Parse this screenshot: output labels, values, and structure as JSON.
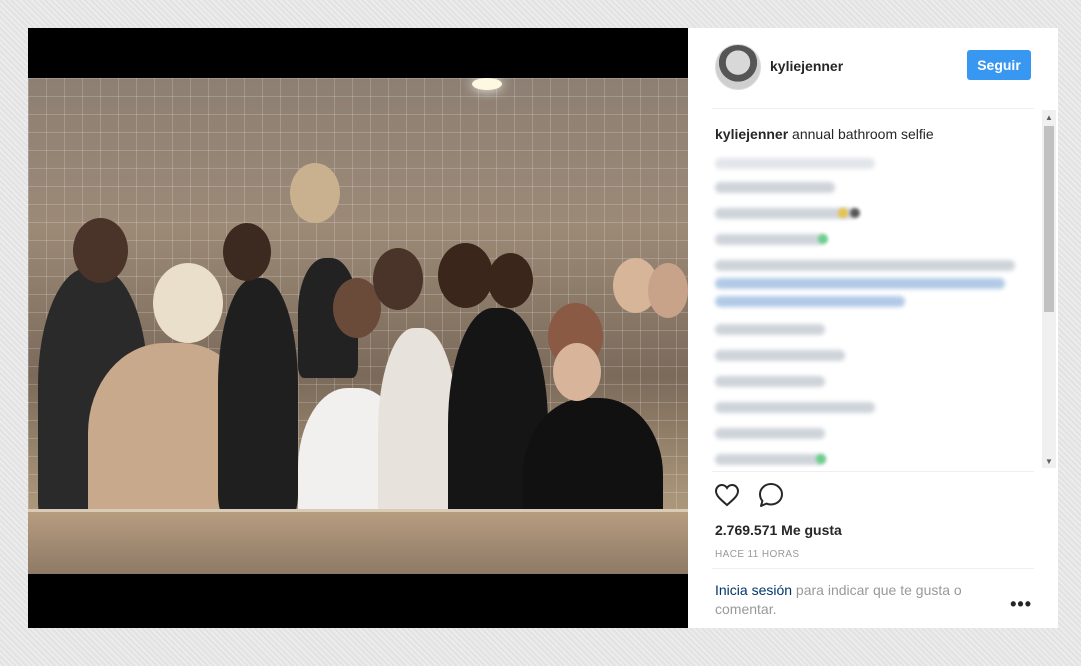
{
  "post": {
    "username": "kyliejenner",
    "follow_label": "Seguir",
    "caption_user": "kyliejenner",
    "caption_text": "annual bathroom selfie",
    "likes_text": "2.769.571 Me gusta",
    "time_text": "HACE 11 HORAS"
  },
  "footer": {
    "login_link": "Inicia sesión",
    "login_rest": " para indicar que te gusta o comentar.",
    "more_label": "•••"
  },
  "icons": {
    "like": "heart-icon",
    "comment": "comment-icon",
    "more": "more-options-icon"
  },
  "colors": {
    "accent": "#3897f0",
    "link": "#003569",
    "text": "#262626",
    "muted": "#999999"
  }
}
